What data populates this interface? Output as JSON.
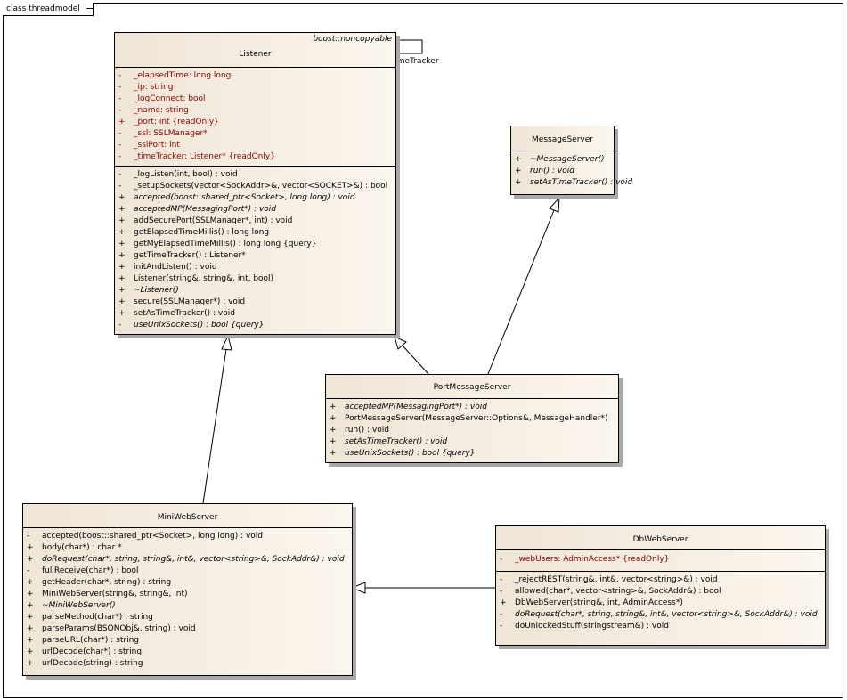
{
  "frame": {
    "label": "class threadmodel"
  },
  "self_association": {
    "label": "-_timeTracker"
  },
  "classes": {
    "listener": {
      "name": "Listener",
      "stereotype": "boost::noncopyable",
      "attributes": [
        {
          "vis": "-",
          "text": "_elapsedTime:  long long"
        },
        {
          "vis": "-",
          "text": "_ip:  string"
        },
        {
          "vis": "-",
          "text": "_logConnect:  bool"
        },
        {
          "vis": "-",
          "text": "_name:  string"
        },
        {
          "vis": "+",
          "text": "_port:  int {readOnly}"
        },
        {
          "vis": "-",
          "text": "_ssl:  SSLManager*"
        },
        {
          "vis": "-",
          "text": "_sslPort:  int"
        },
        {
          "vis": "-",
          "text": "_timeTracker:  Listener* {readOnly}"
        }
      ],
      "operations": [
        {
          "vis": "-",
          "text": "_logListen(int, bool) : void"
        },
        {
          "vis": "-",
          "text": "_setupSockets(vector<SockAddr>&, vector<SOCKET>&) : bool"
        },
        {
          "vis": "+",
          "text": "accepted(boost::shared_ptr<Socket>, long long) : void",
          "italic": true
        },
        {
          "vis": "+",
          "text": "acceptedMP(MessagingPort*) : void",
          "italic": true
        },
        {
          "vis": "+",
          "text": "addSecurePort(SSLManager*, int) : void"
        },
        {
          "vis": "+",
          "text": "getElapsedTimeMillis() : long long"
        },
        {
          "vis": "+",
          "text": "getMyElapsedTimeMillis() : long long {query}"
        },
        {
          "vis": "+",
          "text": "getTimeTracker() : Listener*"
        },
        {
          "vis": "+",
          "text": "initAndListen() : void"
        },
        {
          "vis": "+",
          "text": "Listener(string&, string&, int, bool)"
        },
        {
          "vis": "+",
          "text": "~Listener()",
          "italic": true
        },
        {
          "vis": "+",
          "text": "secure(SSLManager*) : void"
        },
        {
          "vis": "+",
          "text": "setAsTimeTracker() : void"
        },
        {
          "vis": "-",
          "text": "useUnixSockets() : bool {query}",
          "italic": true
        }
      ]
    },
    "message_server": {
      "name": "MessageServer",
      "operations": [
        {
          "vis": "+",
          "text": "~MessageServer()",
          "italic": true
        },
        {
          "vis": "+",
          "text": "run() : void",
          "italic": true
        },
        {
          "vis": "+",
          "text": "setAsTimeTracker() : void",
          "italic": true
        }
      ]
    },
    "port_message_server": {
      "name": "PortMessageServer",
      "operations": [
        {
          "vis": "+",
          "text": "acceptedMP(MessagingPort*) : void",
          "italic": true
        },
        {
          "vis": "+",
          "text": "PortMessageServer(MessageServer::Options&, MessageHandler*)"
        },
        {
          "vis": "+",
          "text": "run() : void"
        },
        {
          "vis": "+",
          "text": "setAsTimeTracker() : void",
          "italic": true
        },
        {
          "vis": "+",
          "text": "useUnixSockets() : bool {query}",
          "italic": true
        }
      ]
    },
    "mini_web_server": {
      "name": "MiniWebServer",
      "operations": [
        {
          "vis": "-",
          "text": "accepted(boost::shared_ptr<Socket>, long long) : void"
        },
        {
          "vis": "+",
          "text": "body(char*) : char *"
        },
        {
          "vis": "+",
          "text": "doRequest(char*, string, string&, int&, vector<string>&, SockAddr&) : void",
          "italic": true
        },
        {
          "vis": "-",
          "text": "fullReceive(char*) : bool"
        },
        {
          "vis": "+",
          "text": "getHeader(char*, string) : string"
        },
        {
          "vis": "+",
          "text": "MiniWebServer(string&, string&, int)"
        },
        {
          "vis": "+",
          "text": "~MiniWebServer()",
          "italic": true
        },
        {
          "vis": "+",
          "text": "parseMethod(char*) : string"
        },
        {
          "vis": "+",
          "text": "parseParams(BSONObj&, string) : void"
        },
        {
          "vis": "+",
          "text": "parseURL(char*) : string"
        },
        {
          "vis": "+",
          "text": "urlDecode(char*) : string"
        },
        {
          "vis": "+",
          "text": "urlDecode(string) : string"
        }
      ]
    },
    "db_web_server": {
      "name": "DbWebServer",
      "attributes": [
        {
          "vis": "-",
          "text": "_webUsers:  AdminAccess* {readOnly}"
        }
      ],
      "operations": [
        {
          "vis": "-",
          "text": "_rejectREST(string&, int&, vector<string>&) : void"
        },
        {
          "vis": "-",
          "text": "allowed(char*, vector<string>&, SockAddr&) : bool"
        },
        {
          "vis": "+",
          "text": "DbWebServer(string&, int, AdminAccess*)"
        },
        {
          "vis": "-",
          "text": "doRequest(char*, string, string&, int&, vector<string>&, SockAddr&) : void",
          "italic": true
        },
        {
          "vis": "-",
          "text": "doUnlockedStuff(stringstream&) : void"
        }
      ]
    }
  }
}
